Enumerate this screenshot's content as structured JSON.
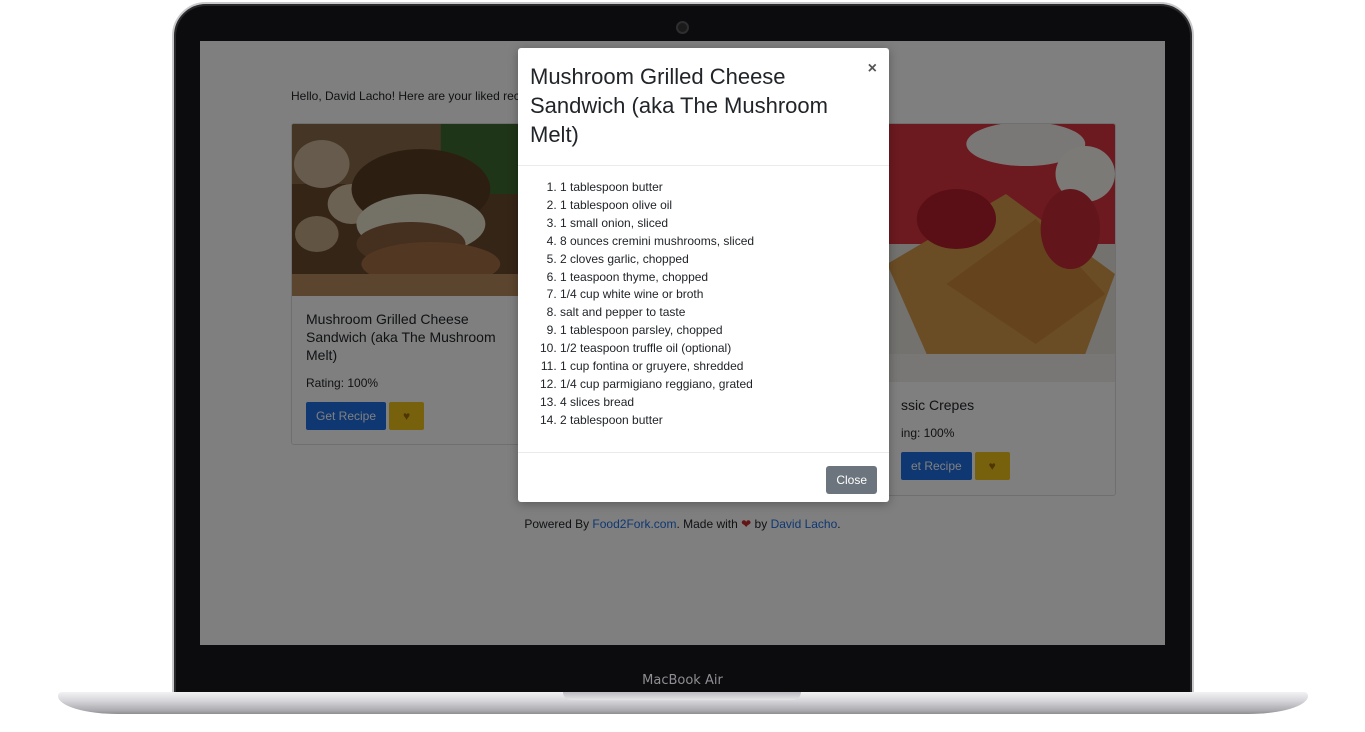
{
  "device": {
    "label": "MacBook Air"
  },
  "page": {
    "greeting": "Hello, David Lacho! Here are your liked rec",
    "cards": [
      {
        "title": "Mushroom Grilled Cheese Sandwich (aka The Mushroom Melt)",
        "rating": "Rating: 100%",
        "button_label": "Get Recipe",
        "heart": "♥"
      },
      {
        "title": "ssic Crepes",
        "rating": "ing: 100%",
        "button_label": "et Recipe",
        "heart": "♥"
      }
    ],
    "footer": {
      "powered_by": "Powered By ",
      "source_link": "Food2Fork.com",
      "made_with": ". Made with ",
      "heart": "❤",
      "by": " by ",
      "author_link": "David Lacho",
      "end": "."
    }
  },
  "modal": {
    "title": "Mushroom Grilled Cheese Sandwich (aka The Mushroom Melt)",
    "close_icon": "×",
    "ingredients": [
      "1 tablespoon butter",
      "1 tablespoon olive oil",
      "1 small onion, sliced",
      "8 ounces cremini mushrooms, sliced",
      "2 cloves garlic, chopped",
      "1 teaspoon thyme, chopped",
      "1/4 cup white wine or broth",
      "salt and pepper to taste",
      "1 tablespoon parsley, chopped",
      "1/2 teaspoon truffle oil (optional)",
      "1 cup fontina or gruyere, shredded",
      "1/4 cup parmigiano reggiano, grated",
      "4 slices bread",
      "2 tablespoon butter"
    ],
    "close_button": "Close"
  },
  "colors": {
    "primary": "#1f6fe5",
    "warning": "#f0c21a",
    "secondary": "#6c757d",
    "backdrop": "rgba(0,0,0,0.5)"
  }
}
